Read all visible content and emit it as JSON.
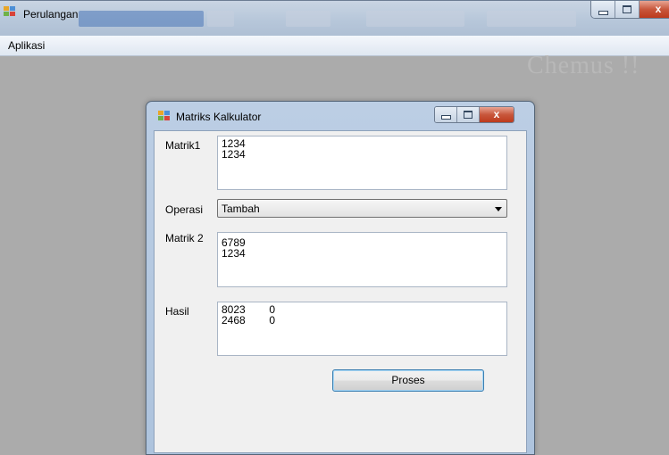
{
  "outer_window": {
    "title": "Perulangan",
    "menu": [
      "Aplikasi"
    ],
    "watermark": "Chemus !!"
  },
  "child_window": {
    "title": "Matriks Kalkulator",
    "matrix1": {
      "label": "Matrik1",
      "lines": [
        "1234",
        "1234"
      ]
    },
    "operation": {
      "label": "Operasi",
      "selected": "Tambah"
    },
    "matrix2": {
      "label": "Matrik 2",
      "lines": [
        "6789",
        "1234"
      ]
    },
    "result": {
      "label": "Hasil",
      "lines": [
        "8023        0",
        "2468        0"
      ]
    },
    "process_button": "Proses"
  },
  "window_controls": {
    "close_glyph": "x"
  },
  "colors": {
    "desktop_bg": "#ababab",
    "titlebar": "#b7c7da",
    "close_button": "#c8573c",
    "button_border": "#3c7fb1"
  }
}
